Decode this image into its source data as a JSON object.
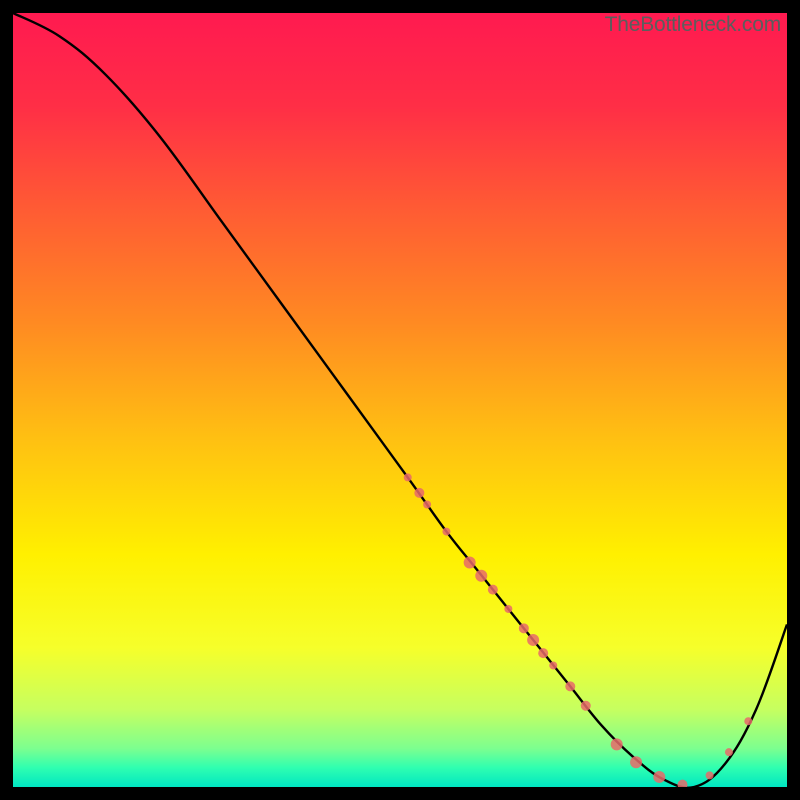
{
  "watermark": "TheBottleneck.com",
  "chart_data": {
    "type": "line",
    "title": "",
    "xlabel": "",
    "ylabel": "",
    "xlim": [
      0,
      100
    ],
    "ylim": [
      0,
      100
    ],
    "background_gradient": {
      "stops": [
        {
          "offset": 0.0,
          "color": "#ff1a50"
        },
        {
          "offset": 0.12,
          "color": "#ff2e46"
        },
        {
          "offset": 0.25,
          "color": "#ff5a34"
        },
        {
          "offset": 0.4,
          "color": "#ff8a22"
        },
        {
          "offset": 0.55,
          "color": "#ffc012"
        },
        {
          "offset": 0.7,
          "color": "#fff000"
        },
        {
          "offset": 0.82,
          "color": "#f6ff2a"
        },
        {
          "offset": 0.9,
          "color": "#c6ff60"
        },
        {
          "offset": 0.95,
          "color": "#7dff8f"
        },
        {
          "offset": 0.975,
          "color": "#2fffb0"
        },
        {
          "offset": 1.0,
          "color": "#00e6c2"
        }
      ]
    },
    "curve": {
      "x": [
        0,
        6,
        12,
        19,
        27,
        35,
        43,
        51,
        56,
        60,
        64,
        68,
        72,
        76,
        80,
        84,
        88,
        92,
        96,
        100
      ],
      "y": [
        100,
        97,
        92,
        84,
        73,
        62,
        51,
        40,
        33,
        28,
        23,
        18,
        13,
        8,
        4,
        1,
        0,
        3,
        10,
        21
      ]
    },
    "markers": [
      {
        "x": 51.0,
        "y": 40.0,
        "r": 4
      },
      {
        "x": 52.5,
        "y": 38.0,
        "r": 5
      },
      {
        "x": 53.5,
        "y": 36.5,
        "r": 4
      },
      {
        "x": 56.0,
        "y": 33.0,
        "r": 4
      },
      {
        "x": 59.0,
        "y": 29.0,
        "r": 6
      },
      {
        "x": 60.5,
        "y": 27.3,
        "r": 6
      },
      {
        "x": 62.0,
        "y": 25.5,
        "r": 5
      },
      {
        "x": 64.0,
        "y": 23.0,
        "r": 4
      },
      {
        "x": 66.0,
        "y": 20.5,
        "r": 5
      },
      {
        "x": 67.2,
        "y": 19.0,
        "r": 6
      },
      {
        "x": 68.5,
        "y": 17.3,
        "r": 5
      },
      {
        "x": 69.8,
        "y": 15.7,
        "r": 4
      },
      {
        "x": 72.0,
        "y": 13.0,
        "r": 5
      },
      {
        "x": 74.0,
        "y": 10.5,
        "r": 5
      },
      {
        "x": 78.0,
        "y": 5.5,
        "r": 6
      },
      {
        "x": 80.5,
        "y": 3.2,
        "r": 6
      },
      {
        "x": 83.5,
        "y": 1.3,
        "r": 6
      },
      {
        "x": 86.5,
        "y": 0.3,
        "r": 5
      },
      {
        "x": 90.0,
        "y": 1.5,
        "r": 4
      },
      {
        "x": 92.5,
        "y": 4.5,
        "r": 4
      },
      {
        "x": 95.0,
        "y": 8.5,
        "r": 4
      }
    ],
    "colors": {
      "curve": "#000000",
      "marker": "#e86a6a"
    }
  }
}
